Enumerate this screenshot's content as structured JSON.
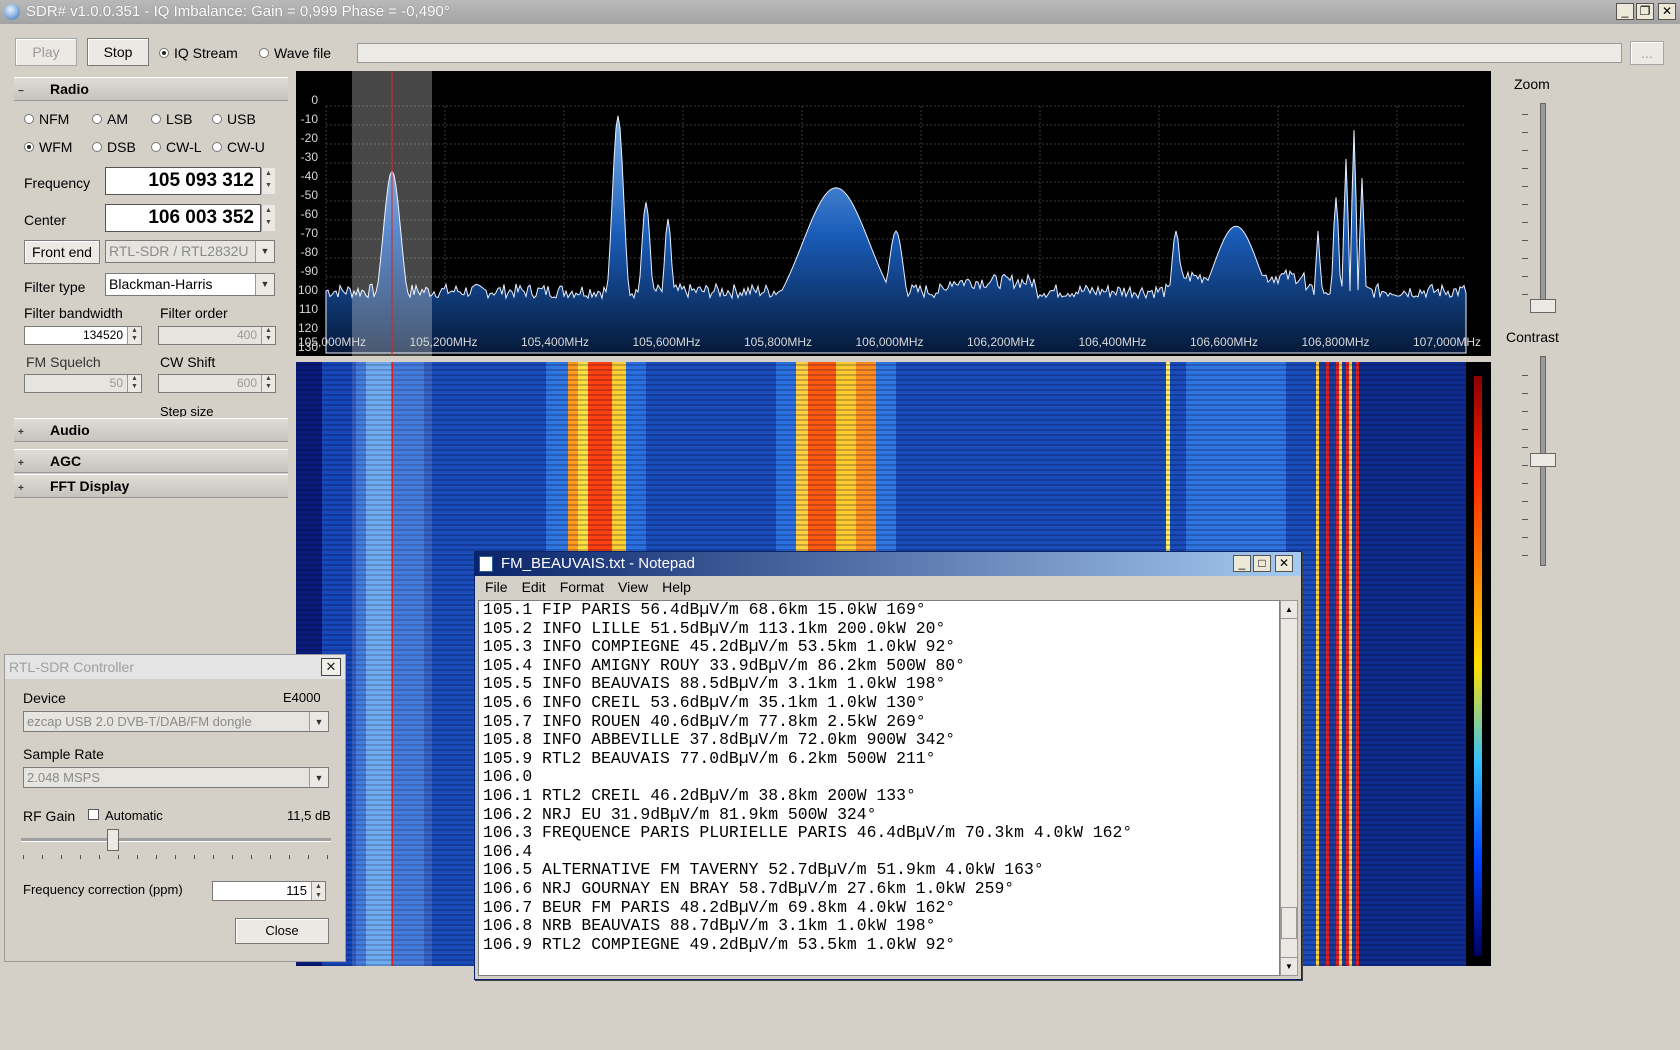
{
  "window": {
    "title": "SDR# v1.0.0.351 - IQ Imbalance: Gain = 0,999 Phase = -0,490°"
  },
  "toolbar": {
    "play": "Play",
    "stop": "Stop",
    "iq_stream": "IQ Stream",
    "wave_file": "Wave file",
    "browse": "..."
  },
  "radio": {
    "section_label": "Radio",
    "modes": [
      "NFM",
      "AM",
      "LSB",
      "USB",
      "WFM",
      "DSB",
      "CW-L",
      "CW-U"
    ],
    "selected_mode": "WFM",
    "frequency_label": "Frequency",
    "frequency_value": "105 093 312",
    "center_label": "Center",
    "center_value": "106 003 352",
    "front_end_label": "Front end",
    "front_end_value": "RTL-SDR / RTL2832U",
    "filter_type_label": "Filter type",
    "filter_type_value": "Blackman-Harris",
    "filter_bandwidth_label": "Filter bandwidth",
    "filter_bandwidth_value": "134520",
    "filter_order_label": "Filter order",
    "filter_order_value": "400",
    "fm_squelch_label": "FM Squelch",
    "fm_squelch_value": "50",
    "cw_shift_label": "CW Shift",
    "cw_shift_value": "600",
    "step_size_label": "Step size"
  },
  "sections": {
    "audio": "Audio",
    "agc": "AGC",
    "fft": "FFT Display"
  },
  "side_controls": {
    "zoom": "Zoom",
    "contrast": "Contrast"
  },
  "spectrum": {
    "db_labels": [
      "0",
      "-10",
      "-20",
      "-30",
      "-40",
      "-50",
      "-60",
      "-70",
      "-80",
      "-90",
      "100",
      "110",
      "120",
      "130"
    ],
    "freq_labels": [
      "105,000MHz",
      "105,200MHz",
      "105,400MHz",
      "105,600MHz",
      "105,800MHz",
      "106,000MHz",
      "106,200MHz",
      "106,400MHz",
      "106,600MHz",
      "106,800MHz",
      "107,000MHz"
    ]
  },
  "notepad": {
    "title": "FM_BEAUVAIS.txt - Notepad",
    "menu": [
      "File",
      "Edit",
      "Format",
      "View",
      "Help"
    ],
    "lines": [
      "105.1 FIP PARIS 56.4dBµV/m 68.6km 15.0kW 169°",
      "105.2 INFO LILLE 51.5dBµV/m 113.1km 200.0kW 20°",
      "105.3 INFO COMPIEGNE 45.2dBµV/m 53.5km 1.0kW 92°",
      "105.4 INFO AMIGNY ROUY 33.9dBµV/m 86.2km 500W 80°",
      "105.5 INFO BEAUVAIS 88.5dBµV/m 3.1km 1.0kW 198°",
      "105.6 INFO CREIL 53.6dBµV/m 35.1km 1.0kW 130°",
      "105.7 INFO ROUEN 40.6dBµV/m 77.8km 2.5kW 269°",
      "105.8 INFO ABBEVILLE 37.8dBµV/m 72.0km 900W 342°",
      "105.9 RTL2 BEAUVAIS 77.0dBµV/m 6.2km 500W 211°",
      "106.0",
      "106.1 RTL2 CREIL 46.2dBµV/m 38.8km 200W 133°",
      "106.2 NRJ EU 31.9dBµV/m 81.9km 500W 324°",
      "106.3 FREQUENCE PARIS PLURIELLE PARIS 46.4dBµV/m 70.3km 4.0kW 162°",
      "106.4",
      "106.5 ALTERNATIVE FM TAVERNY 52.7dBµV/m 51.9km 4.0kW 163°",
      "106.6 NRJ GOURNAY EN BRAY 58.7dBµV/m 27.6km 1.0kW 259°",
      "106.7 BEUR FM PARIS 48.2dBµV/m 69.8km 4.0kW 162°",
      "106.8 NRB BEAUVAIS 88.7dBµV/m 3.1km 1.0kW 198°",
      "106.9 RTL2 COMPIEGNE 49.2dBµV/m 53.5km 1.0kW 92°"
    ]
  },
  "rtl_controller": {
    "title": "RTL-SDR Controller",
    "device_label": "Device",
    "device_tuner": "E4000",
    "device_value": "ezcap USB 2.0 DVB-T/DAB/FM dongle",
    "sample_rate_label": "Sample Rate",
    "sample_rate_value": "2.048 MSPS",
    "rf_gain_label": "RF Gain",
    "automatic_label": "Automatic",
    "rf_gain_value": "11,5 dB",
    "freq_correction_label": "Frequency correction (ppm)",
    "freq_correction_value": "115",
    "close": "Close"
  }
}
